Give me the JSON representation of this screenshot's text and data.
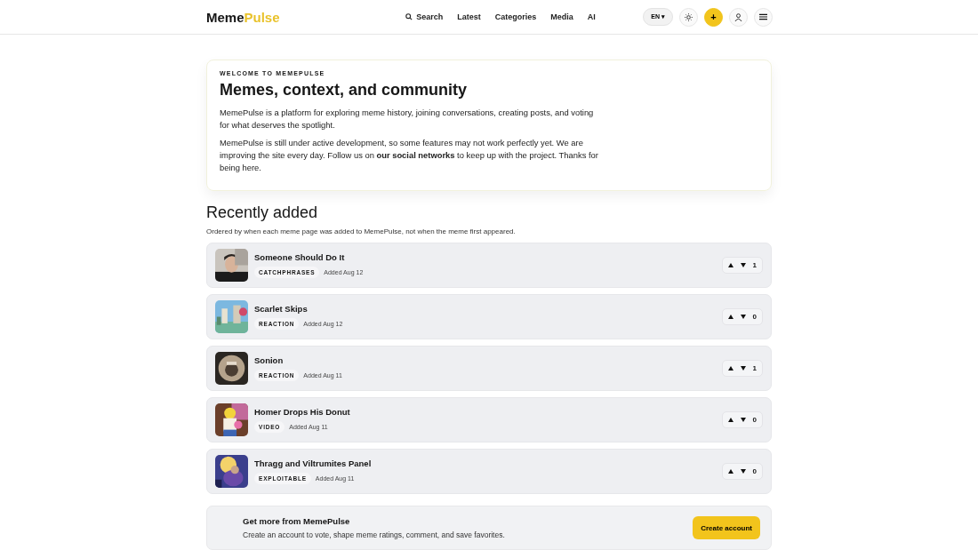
{
  "header": {
    "logo": {
      "part_1": "Meme",
      "part_2": "Pulse"
    },
    "nav": [
      {
        "label": "Search",
        "kind": "search"
      },
      {
        "label": "Latest",
        "kind": "link"
      },
      {
        "label": "Categories",
        "kind": "link"
      },
      {
        "label": "Media",
        "kind": "link"
      },
      {
        "label": "AI",
        "kind": "link"
      }
    ],
    "language": "EN ▾",
    "add": "+"
  },
  "welcome": {
    "eyebrow": "WELCOME TO MEMEPULSE",
    "title": "Memes, context, and community",
    "paragraphs": [
      "MemePulse is a platform for exploring meme history, joining conversations, creating posts, and voting for what deserves the spotlight.",
      "MemePulse is still under active development, so some features may not work perfectly yet. We are improving the site every day. Follow us on **our social networks** to keep up with the project. Thanks for being here."
    ]
  },
  "recent": {
    "title": "Recently added",
    "subtitle": "Ordered by when each meme page was added to MemePulse, not when the meme first appeared.",
    "items": [
      {
        "title": "Someone Should Do It",
        "tag": "CATCHPHRASES",
        "added": "Added Aug 12",
        "score": "1"
      },
      {
        "title": "Scarlet Skips",
        "tag": "REACTION",
        "added": "Added Aug 12",
        "score": "0"
      },
      {
        "title": "Sonion",
        "tag": "REACTION",
        "added": "Added Aug 11",
        "score": "1"
      },
      {
        "title": "Homer Drops His Donut",
        "tag": "VIDEO",
        "added": "Added Aug 11",
        "score": "0"
      },
      {
        "title": "Thragg and Viltrumites Panel",
        "tag": "EXPLOITABLE",
        "added": "Added Aug 11",
        "score": "0"
      }
    ]
  },
  "cta": {
    "title": "Get more from MemePulse",
    "text": "Create an account to vote, shape meme ratings, comment, and save favorites.",
    "button": "Create account"
  }
}
